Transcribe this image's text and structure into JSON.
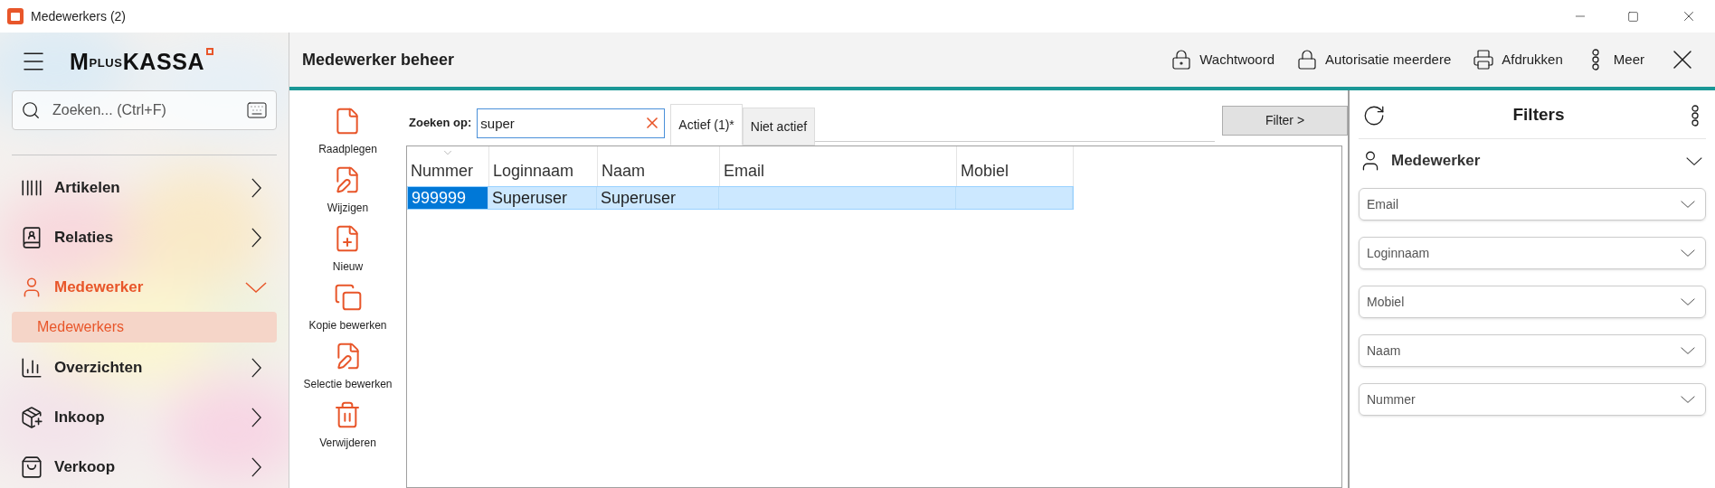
{
  "window": {
    "title": "Medewerkers (2)"
  },
  "sidebar": {
    "logo": {
      "main": "M",
      "small": "plus",
      "tail": "KASSA"
    },
    "search": {
      "placeholder": "Zoeken... (Ctrl+F)"
    },
    "items": [
      {
        "label": "Artikelen",
        "selected": false,
        "expanded": false
      },
      {
        "label": "Relaties",
        "selected": false,
        "expanded": false
      },
      {
        "label": "Medewerker",
        "selected": true,
        "expanded": true,
        "children": [
          {
            "label": "Medewerkers",
            "selected": true
          }
        ]
      },
      {
        "label": "Overzichten",
        "selected": false,
        "expanded": false
      },
      {
        "label": "Inkoop",
        "selected": false,
        "expanded": false
      },
      {
        "label": "Verkoop",
        "selected": false,
        "expanded": false
      }
    ]
  },
  "header": {
    "title": "Medewerker beheer",
    "actions": [
      "Wachtwoord",
      "Autorisatie meerdere",
      "Afdrukken",
      "Meer"
    ]
  },
  "actions": [
    "Raadplegen",
    "Wijzigen",
    "Nieuw",
    "Kopie bewerken",
    "Selectie bewerken",
    "Verwijderen"
  ],
  "search": {
    "label": "Zoeken op:",
    "value": "super"
  },
  "tabs": [
    {
      "label": "Actief (1)*",
      "selected": true
    },
    {
      "label": "Niet actief",
      "selected": false
    }
  ],
  "filter_button": "Filter >",
  "table": {
    "columns": [
      {
        "label": "Nummer",
        "sorted": true
      },
      {
        "label": "Loginnaam",
        "sorted": false
      },
      {
        "label": "Naam",
        "sorted": false
      },
      {
        "label": "Email",
        "sorted": false
      },
      {
        "label": "Mobiel",
        "sorted": false
      }
    ],
    "rows": [
      {
        "cells": [
          "999999",
          "Superuser",
          "Superuser",
          "",
          ""
        ],
        "selected": true
      }
    ]
  },
  "filters": {
    "title": "Filters",
    "section": {
      "label": "Medewerker",
      "expanded": true
    },
    "fields": [
      {
        "placeholder": "Email"
      },
      {
        "placeholder": "Loginnaam"
      },
      {
        "placeholder": "Mobiel"
      },
      {
        "placeholder": "Naam"
      },
      {
        "placeholder": "Nummer"
      }
    ]
  }
}
